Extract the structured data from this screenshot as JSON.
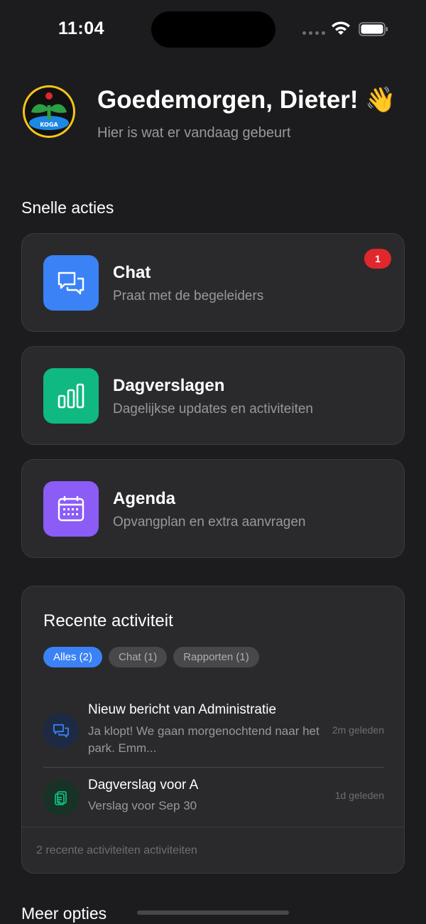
{
  "status_bar": {
    "time": "11:04"
  },
  "header": {
    "greeting": "Goedemorgen, Dieter! 👋",
    "subtitle": "Hier is wat er vandaag gebeurt",
    "logo_text": "KOGA"
  },
  "quick_actions": {
    "title": "Snelle acties",
    "items": [
      {
        "title": "Chat",
        "description": "Praat met de begeleiders",
        "icon": "chat-bubbles-icon",
        "color": "#3b82f6",
        "badge": "1"
      },
      {
        "title": "Dagverslagen",
        "description": "Dagelijkse updates en activiteiten",
        "icon": "bar-chart-icon",
        "color": "#10b981"
      },
      {
        "title": "Agenda",
        "description": "Opvangplan en extra aanvragen",
        "icon": "calendar-icon",
        "color": "#8b5cf6"
      }
    ]
  },
  "recent_activity": {
    "title": "Recente activiteit",
    "filters": [
      {
        "label": "Alles (2)",
        "active": true
      },
      {
        "label": "Chat (1)",
        "active": false
      },
      {
        "label": "Rapporten (1)",
        "active": false
      }
    ],
    "items": [
      {
        "title": "Nieuw bericht van Administratie",
        "text": "Ja klopt! We gaan morgenochtend naar het park. Emm...",
        "time": "2m geleden",
        "icon": "chat-bubbles-icon"
      },
      {
        "title": "Dagverslag voor A",
        "text": "Verslag voor Sep 30",
        "time": "1d geleden",
        "icon": "clipboard-icon"
      }
    ],
    "footer": "2 recente activiteiten activiteiten"
  },
  "more_options": {
    "title": "Meer opties"
  },
  "colors": {
    "background": "#1c1c1e",
    "card": "#2a2a2c",
    "accent": "#3b82f6",
    "badge": "#e0272c"
  }
}
